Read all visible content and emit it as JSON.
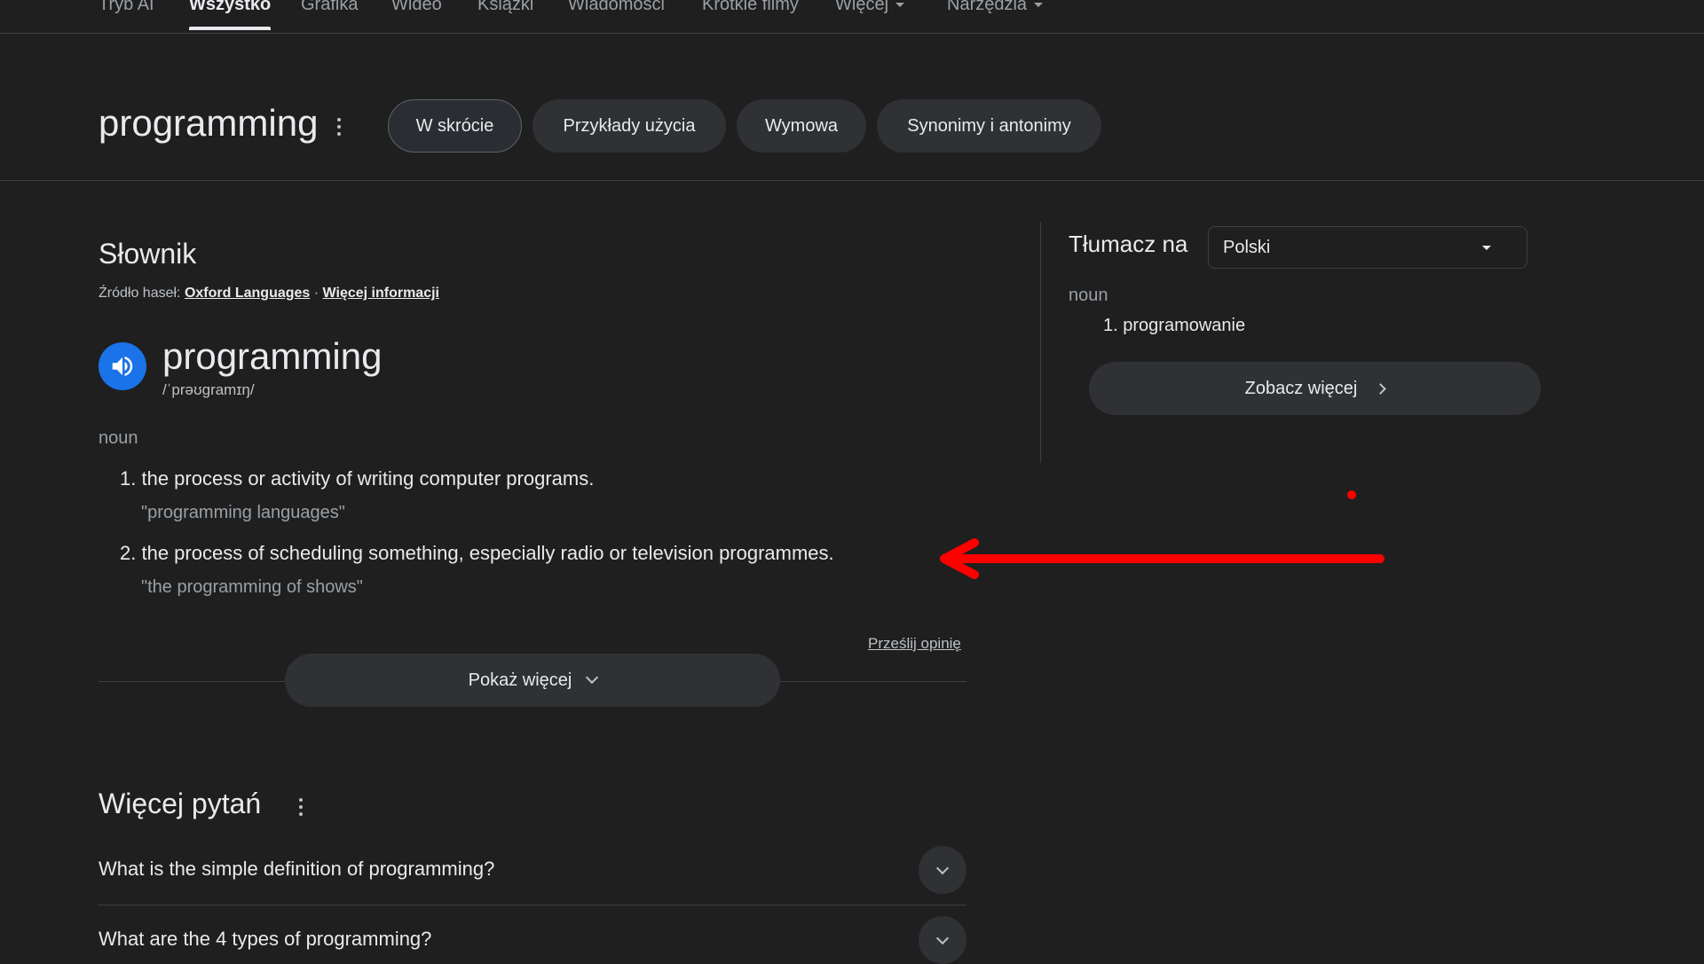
{
  "nav": {
    "tabs": [
      {
        "label": "Tryb AI"
      },
      {
        "label": "Wszystko"
      },
      {
        "label": "Grafika"
      },
      {
        "label": "Wideo"
      },
      {
        "label": "Książki"
      },
      {
        "label": "Wiadomości"
      },
      {
        "label": "Krótkie filmy"
      },
      {
        "label": "Więcej"
      },
      {
        "label": "Narzędzia"
      }
    ],
    "active_tab": "Wszystko"
  },
  "header": {
    "query": "programming",
    "chips": [
      {
        "label": "W skrócie",
        "selected": true
      },
      {
        "label": "Przykłady użycia",
        "selected": false
      },
      {
        "label": "Wymowa",
        "selected": false
      },
      {
        "label": "Synonimy i antonimy",
        "selected": false
      }
    ]
  },
  "dictionary": {
    "heading": "Słownik",
    "source_prefix": "Źródło haseł:",
    "source_link": "Oxford Languages",
    "separator": " · ",
    "more_info_link": "Więcej informacji",
    "word": "programming",
    "phonetic": "/ˈprəʊɡramɪŋ/",
    "part_of_speech": "noun",
    "definitions": [
      {
        "number": "1.",
        "text": "the process or activity of writing computer programs.",
        "example": "\"programming languages\""
      },
      {
        "number": "2.",
        "text": "the process of scheduling something, especially radio or television programmes.",
        "example": "\"the programming of shows\""
      }
    ],
    "feedback_label": "Prześlij opinię",
    "show_more_label": "Pokaż więcej"
  },
  "translate": {
    "label": "Tłumacz na",
    "selected_language": "Polski",
    "part_of_speech": "noun",
    "translations": [
      {
        "number": "1.",
        "text": "programowanie"
      }
    ],
    "see_more_label": "Zobacz więcej"
  },
  "more_questions": {
    "heading": "Więcej pytań",
    "questions": [
      {
        "text": "What is the simple definition of programming?"
      },
      {
        "text": "What are the 4 types of programming?"
      }
    ]
  },
  "colors": {
    "background": "#1f1f1f",
    "chip": "#303134",
    "speaker": "#1a73e8",
    "annotation": "#ff0000"
  },
  "icons": {
    "speaker": "speaker-icon",
    "kebab": "more-vert-icon",
    "chevron_down": "chevron-down-icon",
    "chevron_right": "chevron-right-icon",
    "dropdown": "dropdown-caret-icon",
    "annotation_arrow": "arrow-left-icon"
  }
}
